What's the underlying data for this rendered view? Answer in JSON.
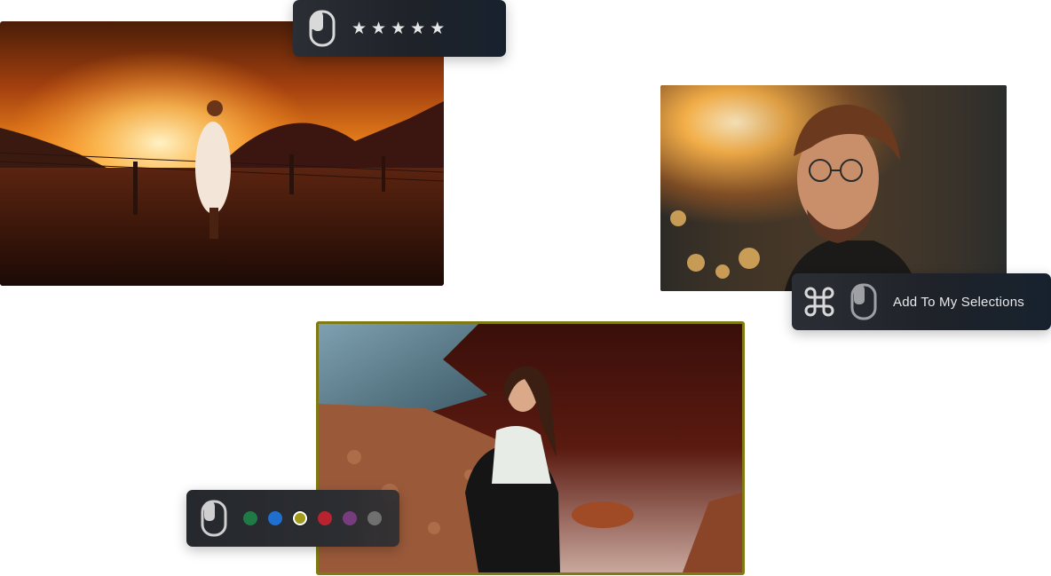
{
  "photos": {
    "sunset": {
      "alt_icon": "photo-sunset-woman"
    },
    "man": {
      "alt_icon": "photo-man-portrait"
    },
    "woman": {
      "alt_icon": "photo-woman-water",
      "frame_color": "#7f7a14"
    }
  },
  "rating_pill": {
    "icon": "mouse-icon",
    "stars": [
      "★",
      "★",
      "★",
      "★",
      "★"
    ],
    "star_color": "#e6e6e6"
  },
  "select_pill": {
    "icon_modifier": "command-key-icon",
    "icon_mouse": "mouse-icon",
    "label": "Add To My Selections"
  },
  "color_pill": {
    "icon": "mouse-icon",
    "colors": [
      {
        "name": "green",
        "hex": "#1f7a45"
      },
      {
        "name": "blue",
        "hex": "#1f6fcf"
      },
      {
        "name": "yellow",
        "hex": "#a19a1b",
        "selected": true
      },
      {
        "name": "red",
        "hex": "#b8232f"
      },
      {
        "name": "purple",
        "hex": "#763c7e"
      },
      {
        "name": "gray",
        "hex": "#707070"
      }
    ]
  }
}
